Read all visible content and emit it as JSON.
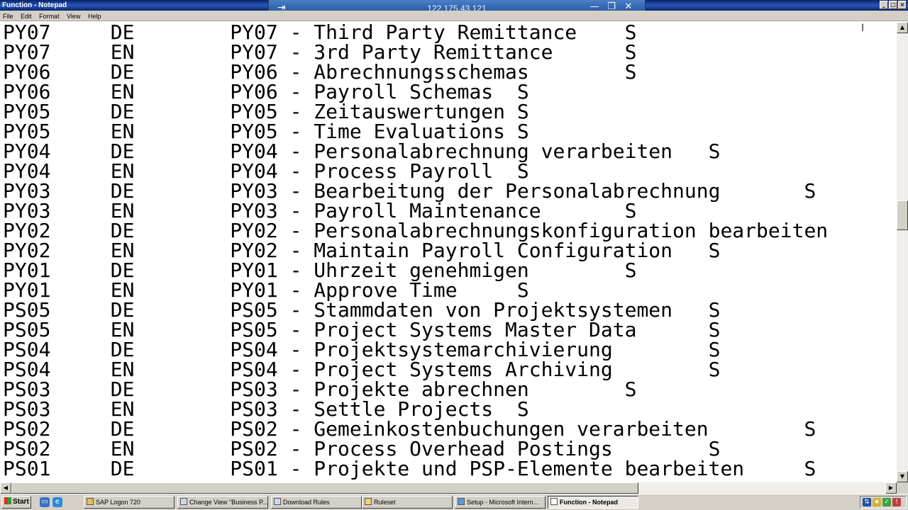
{
  "window": {
    "title": "Function - Notepad",
    "controls": [
      "_",
      "□",
      "×"
    ]
  },
  "remote_bar": {
    "host": "122.175.43.121",
    "pin_icon": "pin-icon",
    "controls": [
      "—",
      "❐",
      "✕"
    ]
  },
  "menu": {
    "items": [
      "File",
      "Edit",
      "Format",
      "View",
      "Help"
    ]
  },
  "document": {
    "lines": [
      "PY07     DE        PY07 - Third Party Remittance    S",
      "PY07     EN        PY07 - 3rd Party Remittance      S",
      "PY06     DE        PY06 - Abrechnungsschemas        S",
      "PY06     EN        PY06 - Payroll Schemas  S",
      "PY05     DE        PY05 - Zeitauswertungen S",
      "PY05     EN        PY05 - Time Evaluations S",
      "PY04     DE        PY04 - Personalabrechnung verarbeiten   S",
      "PY04     EN        PY04 - Process Payroll  S",
      "PY03     DE        PY03 - Bearbeitung der Personalabrechnung       S",
      "PY03     EN        PY03 - Payroll Maintenance       S",
      "PY02     DE        PY02 - Personalabrechnungskonfiguration bearbeiten       S",
      "PY02     EN        PY02 - Maintain Payroll Configuration   S",
      "PY01     DE        PY01 - Uhrzeit genehmigen        S",
      "PY01     EN        PY01 - Approve Time     S",
      "PS05     DE        PS05 - Stammdaten von Projektsystemen   S",
      "PS05     EN        PS05 - Project Systems Master Data      S",
      "PS04     DE        PS04 - Projektsystemarchivierung        S",
      "PS04     EN        PS04 - Project Systems Archiving        S",
      "PS03     DE        PS03 - Projekte abrechnen        S",
      "PS03     EN        PS03 - Settle Projects  S",
      "PS02     DE        PS02 - Gemeinkostenbuchungen verarbeiten        S",
      "PS02     EN        PS02 - Process Overhead Postings        S",
      "PS01     DE        PS01 - Projekte und PSP-Elemente bearbeiten     S"
    ]
  },
  "taskbar": {
    "start_label": "Start",
    "tasks": [
      {
        "label": "SAP Logon 720",
        "active": false
      },
      {
        "label": "Change View \"Business P...",
        "active": false
      },
      {
        "label": "Download Rules",
        "active": false
      },
      {
        "label": "Ruleset",
        "active": false
      },
      {
        "label": "Setup - Microsoft Intern...",
        "active": false
      },
      {
        "label": "Function - Notepad",
        "active": true
      }
    ]
  }
}
